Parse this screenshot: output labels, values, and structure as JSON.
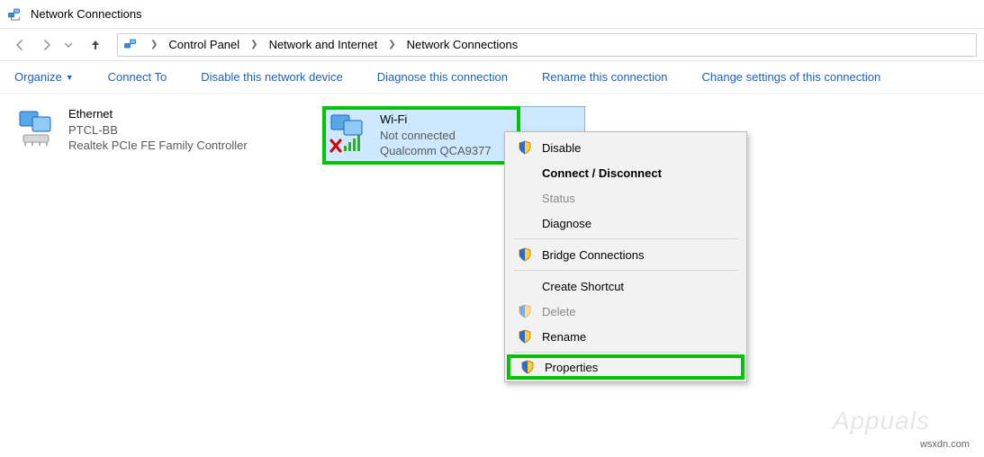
{
  "window": {
    "title": "Network Connections"
  },
  "breadcrumb": {
    "segments": [
      "Control Panel",
      "Network and Internet",
      "Network Connections"
    ]
  },
  "toolbar": {
    "organize": "Organize",
    "connect": "Connect To",
    "disable": "Disable this network device",
    "diagnose": "Diagnose this connection",
    "rename": "Rename this connection",
    "change": "Change settings of this connection"
  },
  "adapters": {
    "ethernet": {
      "name": "Ethernet",
      "status": "PTCL-BB",
      "device": "Realtek PCIe FE Family Controller"
    },
    "wifi": {
      "name": "Wi-Fi",
      "status": "Not connected",
      "device": "Qualcomm QCA9377"
    }
  },
  "context_menu": {
    "disable": "Disable",
    "connect": "Connect / Disconnect",
    "status": "Status",
    "diagnose": "Diagnose",
    "bridge": "Bridge Connections",
    "shortcut": "Create Shortcut",
    "delete": "Delete",
    "rename": "Rename",
    "properties": "Properties"
  },
  "watermark": {
    "brand": "Appuals",
    "src": "wsxdn.com"
  }
}
